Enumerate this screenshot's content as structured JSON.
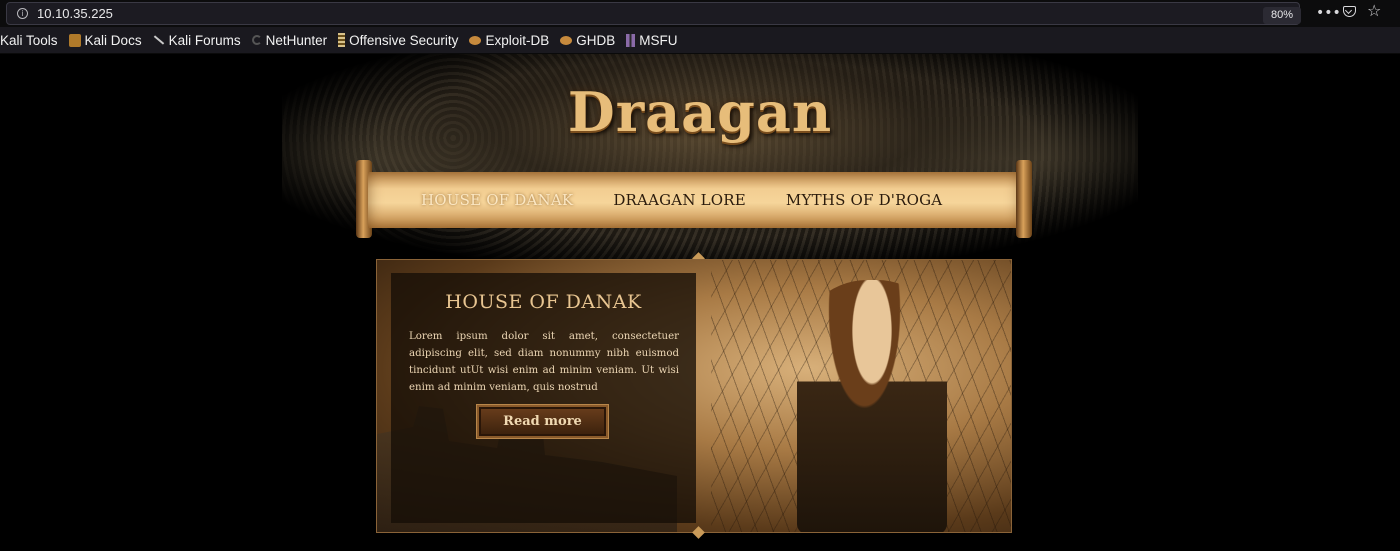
{
  "browser": {
    "url": "10.10.35.225",
    "zoom": "80%",
    "icons": {
      "info": "info-icon",
      "more": "more-dots-icon",
      "pocket": "pocket-icon",
      "bookmark": "star-icon"
    },
    "bookmarks": [
      {
        "label": "Kali Tools",
        "icon": "kali-tools-icon"
      },
      {
        "label": "Kali Docs",
        "icon": "book-icon"
      },
      {
        "label": "Kali Forums",
        "icon": "knife-icon"
      },
      {
        "label": "NetHunter",
        "icon": "nethunter-icon"
      },
      {
        "label": "Offensive Security",
        "icon": "offsec-icon"
      },
      {
        "label": "Exploit-DB",
        "icon": "bug-icon"
      },
      {
        "label": "GHDB",
        "icon": "bug-icon"
      },
      {
        "label": "MSFU",
        "icon": "msf-icon"
      }
    ]
  },
  "site": {
    "logo": "Draagan",
    "nav": [
      {
        "label": "HOUSE OF DANAK",
        "active": true
      },
      {
        "label": "DRAAGAN LORE",
        "active": false
      },
      {
        "label": "MYTHS OF D'ROGA",
        "active": false
      }
    ],
    "feature": {
      "title": "HOUSE OF DANAK",
      "body": "Lorem ipsum dolor sit amet, consectetuer adipiscing elit, sed diam nonummy nibh euismod tincidunt utUt wisi enim ad minim veniam. Ut wisi enim ad minim veniam, quis nostrud",
      "button": "Read more"
    }
  },
  "colors": {
    "accent": "#e7bd7a",
    "nav_active": "#fbe7c3",
    "nav_text": "#2b1b0c"
  }
}
